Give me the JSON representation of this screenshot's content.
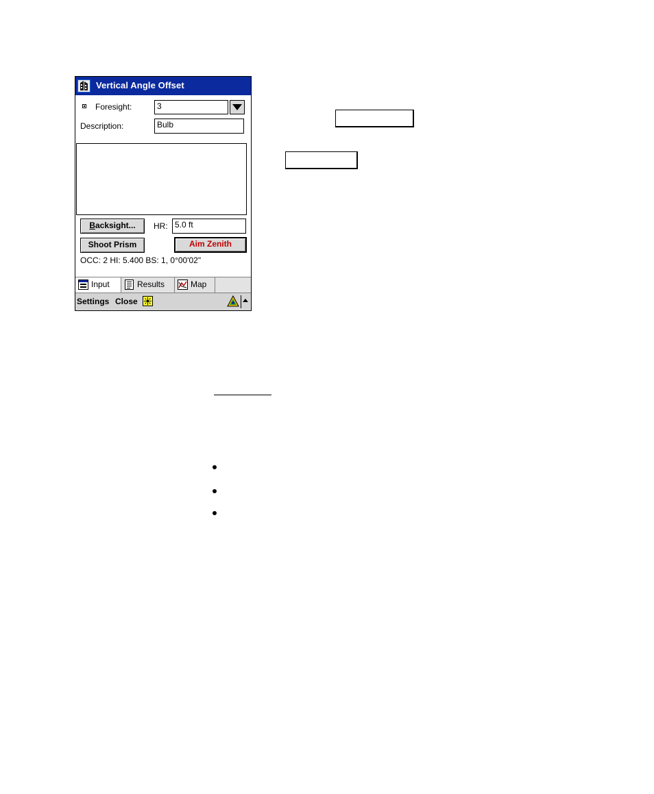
{
  "window": {
    "title": "Vertical Angle Offset",
    "app_icon": "survey-app-icon",
    "title_bar_color": "#0a2a9e"
  },
  "form": {
    "foresight_label": "Foresight:",
    "foresight_value": "3",
    "description_label": "Description:",
    "description_value": "Bulb",
    "notes_value": "",
    "backsight_button": "Backsight...",
    "backsight_accelerator": "B",
    "backsight_rest": "acksight...",
    "hr_label": "HR:",
    "hr_value": "5.0 ft",
    "shoot_prism_button": "Shoot Prism",
    "aim_zenith_button": "Aim Zenith",
    "aim_zenith_color": "#c00000",
    "status_line": "OCC: 2  HI: 5.400  BS: 1, 0°00'02\""
  },
  "tabs": [
    {
      "label": "Input",
      "icon": "input-tab-icon",
      "selected": true
    },
    {
      "label": "Results",
      "icon": "results-tab-icon",
      "selected": false
    },
    {
      "label": "Map",
      "icon": "map-tab-icon",
      "selected": false
    }
  ],
  "command_bar": {
    "settings_label": "Settings",
    "close_label": "Close",
    "icons": [
      "sun-icon",
      "triangle-status-icon",
      "up-arrow-icon"
    ]
  },
  "page": {
    "placeholders": [
      "blank-box",
      "blank-box",
      "blank-underline"
    ],
    "bullet_count": 3
  }
}
